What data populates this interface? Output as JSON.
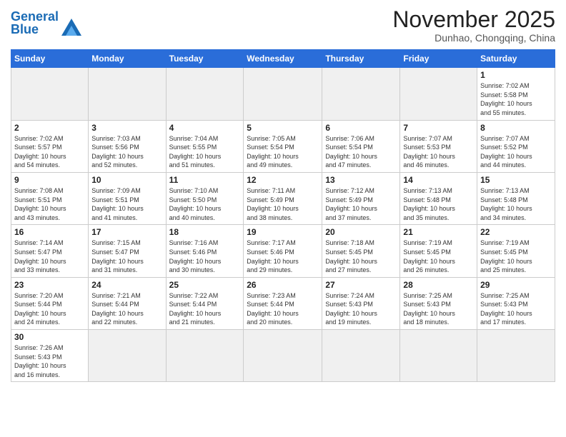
{
  "header": {
    "logo_general": "General",
    "logo_blue": "Blue",
    "month_title": "November 2025",
    "location": "Dunhao, Chongqing, China"
  },
  "days_of_week": [
    "Sunday",
    "Monday",
    "Tuesday",
    "Wednesday",
    "Thursday",
    "Friday",
    "Saturday"
  ],
  "weeks": [
    [
      {
        "day": "",
        "info": "",
        "empty": true
      },
      {
        "day": "",
        "info": "",
        "empty": true
      },
      {
        "day": "",
        "info": "",
        "empty": true
      },
      {
        "day": "",
        "info": "",
        "empty": true
      },
      {
        "day": "",
        "info": "",
        "empty": true
      },
      {
        "day": "",
        "info": "",
        "empty": true
      },
      {
        "day": "1",
        "info": "Sunrise: 7:02 AM\nSunset: 5:58 PM\nDaylight: 10 hours\nand 55 minutes."
      }
    ],
    [
      {
        "day": "2",
        "info": "Sunrise: 7:02 AM\nSunset: 5:57 PM\nDaylight: 10 hours\nand 54 minutes."
      },
      {
        "day": "3",
        "info": "Sunrise: 7:03 AM\nSunset: 5:56 PM\nDaylight: 10 hours\nand 52 minutes."
      },
      {
        "day": "4",
        "info": "Sunrise: 7:04 AM\nSunset: 5:55 PM\nDaylight: 10 hours\nand 51 minutes."
      },
      {
        "day": "5",
        "info": "Sunrise: 7:05 AM\nSunset: 5:54 PM\nDaylight: 10 hours\nand 49 minutes."
      },
      {
        "day": "6",
        "info": "Sunrise: 7:06 AM\nSunset: 5:54 PM\nDaylight: 10 hours\nand 47 minutes."
      },
      {
        "day": "7",
        "info": "Sunrise: 7:07 AM\nSunset: 5:53 PM\nDaylight: 10 hours\nand 46 minutes."
      },
      {
        "day": "8",
        "info": "Sunrise: 7:07 AM\nSunset: 5:52 PM\nDaylight: 10 hours\nand 44 minutes."
      }
    ],
    [
      {
        "day": "9",
        "info": "Sunrise: 7:08 AM\nSunset: 5:51 PM\nDaylight: 10 hours\nand 43 minutes."
      },
      {
        "day": "10",
        "info": "Sunrise: 7:09 AM\nSunset: 5:51 PM\nDaylight: 10 hours\nand 41 minutes."
      },
      {
        "day": "11",
        "info": "Sunrise: 7:10 AM\nSunset: 5:50 PM\nDaylight: 10 hours\nand 40 minutes."
      },
      {
        "day": "12",
        "info": "Sunrise: 7:11 AM\nSunset: 5:49 PM\nDaylight: 10 hours\nand 38 minutes."
      },
      {
        "day": "13",
        "info": "Sunrise: 7:12 AM\nSunset: 5:49 PM\nDaylight: 10 hours\nand 37 minutes."
      },
      {
        "day": "14",
        "info": "Sunrise: 7:13 AM\nSunset: 5:48 PM\nDaylight: 10 hours\nand 35 minutes."
      },
      {
        "day": "15",
        "info": "Sunrise: 7:13 AM\nSunset: 5:48 PM\nDaylight: 10 hours\nand 34 minutes."
      }
    ],
    [
      {
        "day": "16",
        "info": "Sunrise: 7:14 AM\nSunset: 5:47 PM\nDaylight: 10 hours\nand 33 minutes."
      },
      {
        "day": "17",
        "info": "Sunrise: 7:15 AM\nSunset: 5:47 PM\nDaylight: 10 hours\nand 31 minutes."
      },
      {
        "day": "18",
        "info": "Sunrise: 7:16 AM\nSunset: 5:46 PM\nDaylight: 10 hours\nand 30 minutes."
      },
      {
        "day": "19",
        "info": "Sunrise: 7:17 AM\nSunset: 5:46 PM\nDaylight: 10 hours\nand 29 minutes."
      },
      {
        "day": "20",
        "info": "Sunrise: 7:18 AM\nSunset: 5:45 PM\nDaylight: 10 hours\nand 27 minutes."
      },
      {
        "day": "21",
        "info": "Sunrise: 7:19 AM\nSunset: 5:45 PM\nDaylight: 10 hours\nand 26 minutes."
      },
      {
        "day": "22",
        "info": "Sunrise: 7:19 AM\nSunset: 5:45 PM\nDaylight: 10 hours\nand 25 minutes."
      }
    ],
    [
      {
        "day": "23",
        "info": "Sunrise: 7:20 AM\nSunset: 5:44 PM\nDaylight: 10 hours\nand 24 minutes."
      },
      {
        "day": "24",
        "info": "Sunrise: 7:21 AM\nSunset: 5:44 PM\nDaylight: 10 hours\nand 22 minutes."
      },
      {
        "day": "25",
        "info": "Sunrise: 7:22 AM\nSunset: 5:44 PM\nDaylight: 10 hours\nand 21 minutes."
      },
      {
        "day": "26",
        "info": "Sunrise: 7:23 AM\nSunset: 5:44 PM\nDaylight: 10 hours\nand 20 minutes."
      },
      {
        "day": "27",
        "info": "Sunrise: 7:24 AM\nSunset: 5:43 PM\nDaylight: 10 hours\nand 19 minutes."
      },
      {
        "day": "28",
        "info": "Sunrise: 7:25 AM\nSunset: 5:43 PM\nDaylight: 10 hours\nand 18 minutes."
      },
      {
        "day": "29",
        "info": "Sunrise: 7:25 AM\nSunset: 5:43 PM\nDaylight: 10 hours\nand 17 minutes."
      }
    ],
    [
      {
        "day": "30",
        "info": "Sunrise: 7:26 AM\nSunset: 5:43 PM\nDaylight: 10 hours\nand 16 minutes."
      },
      {
        "day": "",
        "info": "",
        "empty": true
      },
      {
        "day": "",
        "info": "",
        "empty": true
      },
      {
        "day": "",
        "info": "",
        "empty": true
      },
      {
        "day": "",
        "info": "",
        "empty": true
      },
      {
        "day": "",
        "info": "",
        "empty": true
      },
      {
        "day": "",
        "info": "",
        "empty": true
      }
    ]
  ]
}
